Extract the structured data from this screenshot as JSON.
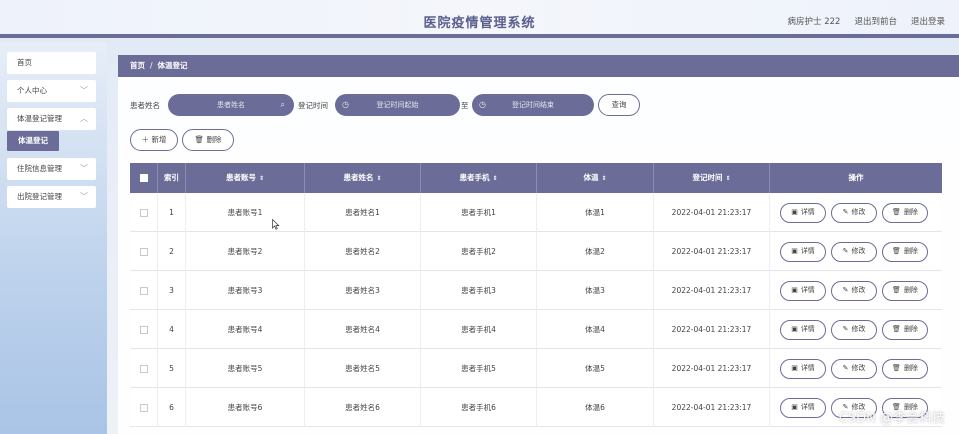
{
  "header": {
    "title": "医院疫情管理系统",
    "user": "病房护士 222",
    "to_front": "退出到前台",
    "logout": "退出登录"
  },
  "sidebar": {
    "items": [
      {
        "label": "首页",
        "has_chevron": false
      },
      {
        "label": "个人中心",
        "has_chevron": true
      },
      {
        "label": "体温登记管理",
        "has_chevron": true
      },
      {
        "label": "住院信息管理",
        "has_chevron": true
      },
      {
        "label": "出院登记管理",
        "has_chevron": true
      }
    ],
    "active_sub": "体温登记"
  },
  "breadcrumb": {
    "home": "首页",
    "sep": "/",
    "current": "体温登记"
  },
  "search": {
    "name_label": "患者姓名",
    "name_placeholder": "患者姓名",
    "time_label": "登记时间",
    "start_placeholder": "登记时间起始",
    "to_label": "至",
    "end_placeholder": "登记时间结束",
    "query_button": "查询"
  },
  "actions": {
    "add": "新增",
    "delete": "删除"
  },
  "table": {
    "columns": [
      "索引",
      "患者账号",
      "患者姓名",
      "患者手机",
      "体温",
      "登记时间",
      "操作"
    ],
    "rows": [
      {
        "idx": "1",
        "account": "患者账号1",
        "name": "患者姓名1",
        "phone": "患者手机1",
        "temp": "体温1",
        "time": "2022-04-01 21:23:17"
      },
      {
        "idx": "2",
        "account": "患者账号2",
        "name": "患者姓名2",
        "phone": "患者手机2",
        "temp": "体温2",
        "time": "2022-04-01 21:23:17"
      },
      {
        "idx": "3",
        "account": "患者账号3",
        "name": "患者姓名3",
        "phone": "患者手机3",
        "temp": "体温3",
        "time": "2022-04-01 21:23:17"
      },
      {
        "idx": "4",
        "account": "患者账号4",
        "name": "患者姓名4",
        "phone": "患者手机4",
        "temp": "体温4",
        "time": "2022-04-01 21:23:17"
      },
      {
        "idx": "5",
        "account": "患者账号5",
        "name": "患者姓名5",
        "phone": "患者手机5",
        "temp": "体温5",
        "time": "2022-04-01 21:23:17"
      },
      {
        "idx": "6",
        "account": "患者账号6",
        "name": "患者姓名6",
        "phone": "患者手机6",
        "temp": "体温6",
        "time": "2022-04-01 21:23:17"
      }
    ],
    "row_actions": {
      "detail": "详情",
      "edit": "修改",
      "delete": "删除"
    }
  },
  "watermark": "CSDN @李会科技",
  "colors": {
    "accent": "#6b6d98"
  },
  "icons": [
    "search-icon",
    "clock-icon",
    "plus-icon",
    "trash-icon",
    "detail-icon",
    "edit-icon",
    "chevron-down-icon",
    "sort-icon"
  ]
}
